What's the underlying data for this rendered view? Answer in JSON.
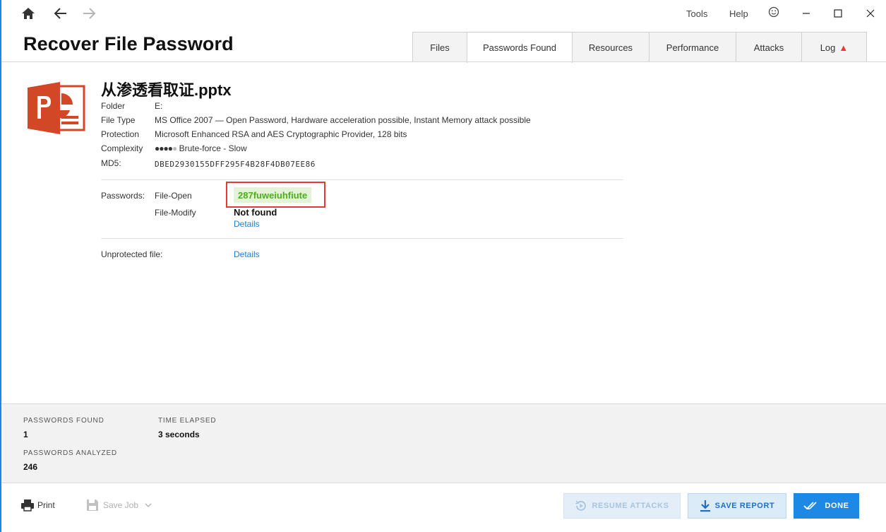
{
  "colors": {
    "accent": "#1e88e5",
    "highlight_border": "#e53935",
    "password_text": "#4caf1a",
    "password_bg": "#e3f3d7",
    "link": "#1e7bd6"
  },
  "topbar": {
    "menu": {
      "tools": "Tools",
      "help": "Help"
    },
    "icons": [
      "home-icon",
      "back-arrow-icon",
      "forward-arrow-icon",
      "smiley-icon",
      "minimize-icon",
      "maximize-icon",
      "close-icon"
    ]
  },
  "header": {
    "title": "Recover File Password",
    "tabs": [
      {
        "label": "Files",
        "active": false
      },
      {
        "label": "Passwords Found",
        "active": true
      },
      {
        "label": "Resources",
        "active": false
      },
      {
        "label": "Performance",
        "active": false
      },
      {
        "label": "Attacks",
        "active": false
      },
      {
        "label": "Log",
        "active": false
      }
    ],
    "log_warning_glyph": "▲"
  },
  "file": {
    "name": "从渗透看取证.pptx",
    "icon": "powerpoint-icon",
    "rows": [
      {
        "key": "Folder",
        "value": "E:"
      },
      {
        "key": "File Type",
        "value": "MS Office 2007 — Open Password, Hardware acceleration possible, Instant Memory attack possible"
      },
      {
        "key": "Protection",
        "value": "Microsoft Enhanced RSA and AES Cryptographic Provider, 128 bits"
      },
      {
        "key": "Complexity",
        "value": "Brute-force - Slow",
        "level_filled": 4,
        "level_total": 5
      },
      {
        "key": "MD5:",
        "value": "DBED2930155DFF295F4B28F4DB07EE86"
      }
    ]
  },
  "passwords": {
    "label": "Passwords:",
    "file_open_label": "File-Open",
    "file_open_value": "287fuweiuhfiute",
    "file_modify_label": "File-Modify",
    "file_modify_value": "Not found",
    "details_link": "Details"
  },
  "unprotected": {
    "label": "Unprotected file:",
    "details_link": "Details"
  },
  "stats": {
    "passwords_found_label": "PASSWORDS FOUND",
    "passwords_found_value": "1",
    "time_elapsed_label": "TIME ELAPSED",
    "time_elapsed_value": "3 seconds",
    "passwords_analyzed_label": "PASSWORDS ANALYZED",
    "passwords_analyzed_value": "246"
  },
  "footer": {
    "print_label": "Print",
    "save_job_label": "Save Job",
    "resume_label": "RESUME ATTACKS",
    "save_report_label": "SAVE REPORT",
    "done_label": "DONE"
  }
}
